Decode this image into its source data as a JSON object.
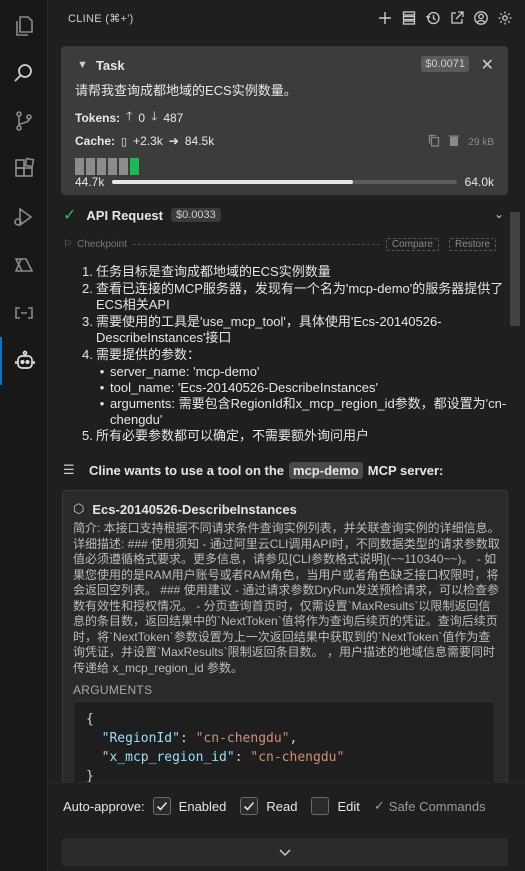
{
  "header": {
    "title": "CLINE (⌘+')"
  },
  "task": {
    "label": "Task",
    "cost": "$0.0071",
    "text": "请帮我查询成都地域的ECS实例数量。",
    "tokens_label": "Tokens:",
    "tokens_in": "0",
    "tokens_out": "487",
    "cache_label": "Cache:",
    "cache_write": "+2.3k",
    "cache_read": "84.5k",
    "size": "29 kB",
    "context_used": "44.7k",
    "context_max": "64.0k",
    "context_fraction": 0.7
  },
  "api": {
    "title": "API Request",
    "cost": "$0.0033"
  },
  "checkpoint": {
    "label": "Checkpoint",
    "compare": "Compare",
    "restore": "Restore"
  },
  "steps": [
    {
      "num": "1.",
      "text": "任务目标是查询成都地域的ECS实例数量"
    },
    {
      "num": "2.",
      "text": "查看已连接的MCP服务器，发现有一个名为'mcp-demo'的服务器提供了ECS相关API"
    },
    {
      "num": "3.",
      "text": "需要使用的工具是'use_mcp_tool'，具体使用'Ecs-20140526-DescribeInstances'接口"
    },
    {
      "num": "4.",
      "text": "需要提供的参数："
    },
    {
      "num": "5.",
      "text": "所有必要参数都可以确定，不需要额外询问用户"
    }
  ],
  "sub_items": [
    "server_name: 'mcp-demo'",
    "tool_name: 'Ecs-20140526-DescribeInstances'",
    "arguments: 需要包含RegionId和x_mcp_region_id参数，都设置为'cn-chengdu'"
  ],
  "mcp": {
    "prefix": "Cline wants to use a tool on the",
    "server": "mcp-demo",
    "suffix": "MCP server:"
  },
  "tool": {
    "name": "Ecs-20140526-DescribeInstances",
    "description": "简介: 本接口支持根据不同请求条件查询实例列表，并关联查询实例的详细信息。 详细描述: ### 使用须知 - 通过阿里云CLI调用API时，不同数据类型的请求参数取值必须遵循格式要求。更多信息，请参见[CLI参数格式说明](~~110340~~)。 - 如果您使用的是RAM用户账号或者RAM角色，当用户或者角色缺乏接口权限时，将会返回空列表。 ### 使用建议 - 通过请求参数DryRun发送预检请求，可以检查参数有效性和授权情况。 - 分页查询首页时，仅需设置`MaxResults`以限制返回信息的条目数，返回结果中的`NextToken`值将作为查询后续页的凭证。查询后续页时，将`NextToken`参数设置为上一次返回结果中获取到的`NextToken`值作为查询凭证，并设置`MaxResults`限制返回条目数。 ，用户描述的地域信息需要同时传递给 x_mcp_region_id 参数。",
    "args_label": "ARGUMENTS",
    "args": {
      "open": "{",
      "key1": "\"RegionId\"",
      "val1": "\"cn-chengdu\"",
      "key2": "\"x_mcp_region_id\"",
      "val2": "\"cn-chengdu\"",
      "close": "}"
    }
  },
  "auto_approve": {
    "label": "Auto-approve:",
    "options": [
      {
        "label": "Enabled",
        "checked": true
      },
      {
        "label": "Read",
        "checked": true
      },
      {
        "label": "Edit",
        "checked": false
      }
    ],
    "safe": "Safe Commands"
  }
}
